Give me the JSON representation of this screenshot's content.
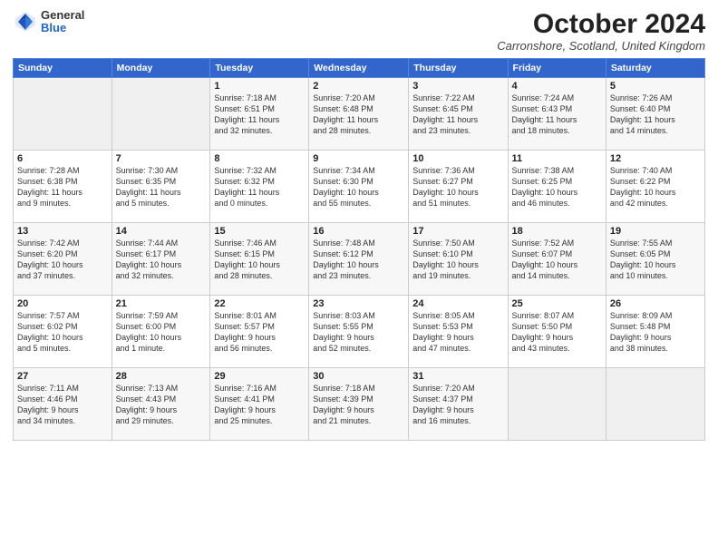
{
  "logo": {
    "general": "General",
    "blue": "Blue"
  },
  "title": "October 2024",
  "location": "Carronshore, Scotland, United Kingdom",
  "headers": [
    "Sunday",
    "Monday",
    "Tuesday",
    "Wednesday",
    "Thursday",
    "Friday",
    "Saturday"
  ],
  "weeks": [
    [
      {
        "num": "",
        "info": ""
      },
      {
        "num": "",
        "info": ""
      },
      {
        "num": "1",
        "info": "Sunrise: 7:18 AM\nSunset: 6:51 PM\nDaylight: 11 hours\nand 32 minutes."
      },
      {
        "num": "2",
        "info": "Sunrise: 7:20 AM\nSunset: 6:48 PM\nDaylight: 11 hours\nand 28 minutes."
      },
      {
        "num": "3",
        "info": "Sunrise: 7:22 AM\nSunset: 6:45 PM\nDaylight: 11 hours\nand 23 minutes."
      },
      {
        "num": "4",
        "info": "Sunrise: 7:24 AM\nSunset: 6:43 PM\nDaylight: 11 hours\nand 18 minutes."
      },
      {
        "num": "5",
        "info": "Sunrise: 7:26 AM\nSunset: 6:40 PM\nDaylight: 11 hours\nand 14 minutes."
      }
    ],
    [
      {
        "num": "6",
        "info": "Sunrise: 7:28 AM\nSunset: 6:38 PM\nDaylight: 11 hours\nand 9 minutes."
      },
      {
        "num": "7",
        "info": "Sunrise: 7:30 AM\nSunset: 6:35 PM\nDaylight: 11 hours\nand 5 minutes."
      },
      {
        "num": "8",
        "info": "Sunrise: 7:32 AM\nSunset: 6:32 PM\nDaylight: 11 hours\nand 0 minutes."
      },
      {
        "num": "9",
        "info": "Sunrise: 7:34 AM\nSunset: 6:30 PM\nDaylight: 10 hours\nand 55 minutes."
      },
      {
        "num": "10",
        "info": "Sunrise: 7:36 AM\nSunset: 6:27 PM\nDaylight: 10 hours\nand 51 minutes."
      },
      {
        "num": "11",
        "info": "Sunrise: 7:38 AM\nSunset: 6:25 PM\nDaylight: 10 hours\nand 46 minutes."
      },
      {
        "num": "12",
        "info": "Sunrise: 7:40 AM\nSunset: 6:22 PM\nDaylight: 10 hours\nand 42 minutes."
      }
    ],
    [
      {
        "num": "13",
        "info": "Sunrise: 7:42 AM\nSunset: 6:20 PM\nDaylight: 10 hours\nand 37 minutes."
      },
      {
        "num": "14",
        "info": "Sunrise: 7:44 AM\nSunset: 6:17 PM\nDaylight: 10 hours\nand 32 minutes."
      },
      {
        "num": "15",
        "info": "Sunrise: 7:46 AM\nSunset: 6:15 PM\nDaylight: 10 hours\nand 28 minutes."
      },
      {
        "num": "16",
        "info": "Sunrise: 7:48 AM\nSunset: 6:12 PM\nDaylight: 10 hours\nand 23 minutes."
      },
      {
        "num": "17",
        "info": "Sunrise: 7:50 AM\nSunset: 6:10 PM\nDaylight: 10 hours\nand 19 minutes."
      },
      {
        "num": "18",
        "info": "Sunrise: 7:52 AM\nSunset: 6:07 PM\nDaylight: 10 hours\nand 14 minutes."
      },
      {
        "num": "19",
        "info": "Sunrise: 7:55 AM\nSunset: 6:05 PM\nDaylight: 10 hours\nand 10 minutes."
      }
    ],
    [
      {
        "num": "20",
        "info": "Sunrise: 7:57 AM\nSunset: 6:02 PM\nDaylight: 10 hours\nand 5 minutes."
      },
      {
        "num": "21",
        "info": "Sunrise: 7:59 AM\nSunset: 6:00 PM\nDaylight: 10 hours\nand 1 minute."
      },
      {
        "num": "22",
        "info": "Sunrise: 8:01 AM\nSunset: 5:57 PM\nDaylight: 9 hours\nand 56 minutes."
      },
      {
        "num": "23",
        "info": "Sunrise: 8:03 AM\nSunset: 5:55 PM\nDaylight: 9 hours\nand 52 minutes."
      },
      {
        "num": "24",
        "info": "Sunrise: 8:05 AM\nSunset: 5:53 PM\nDaylight: 9 hours\nand 47 minutes."
      },
      {
        "num": "25",
        "info": "Sunrise: 8:07 AM\nSunset: 5:50 PM\nDaylight: 9 hours\nand 43 minutes."
      },
      {
        "num": "26",
        "info": "Sunrise: 8:09 AM\nSunset: 5:48 PM\nDaylight: 9 hours\nand 38 minutes."
      }
    ],
    [
      {
        "num": "27",
        "info": "Sunrise: 7:11 AM\nSunset: 4:46 PM\nDaylight: 9 hours\nand 34 minutes."
      },
      {
        "num": "28",
        "info": "Sunrise: 7:13 AM\nSunset: 4:43 PM\nDaylight: 9 hours\nand 29 minutes."
      },
      {
        "num": "29",
        "info": "Sunrise: 7:16 AM\nSunset: 4:41 PM\nDaylight: 9 hours\nand 25 minutes."
      },
      {
        "num": "30",
        "info": "Sunrise: 7:18 AM\nSunset: 4:39 PM\nDaylight: 9 hours\nand 21 minutes."
      },
      {
        "num": "31",
        "info": "Sunrise: 7:20 AM\nSunset: 4:37 PM\nDaylight: 9 hours\nand 16 minutes."
      },
      {
        "num": "",
        "info": ""
      },
      {
        "num": "",
        "info": ""
      }
    ]
  ]
}
